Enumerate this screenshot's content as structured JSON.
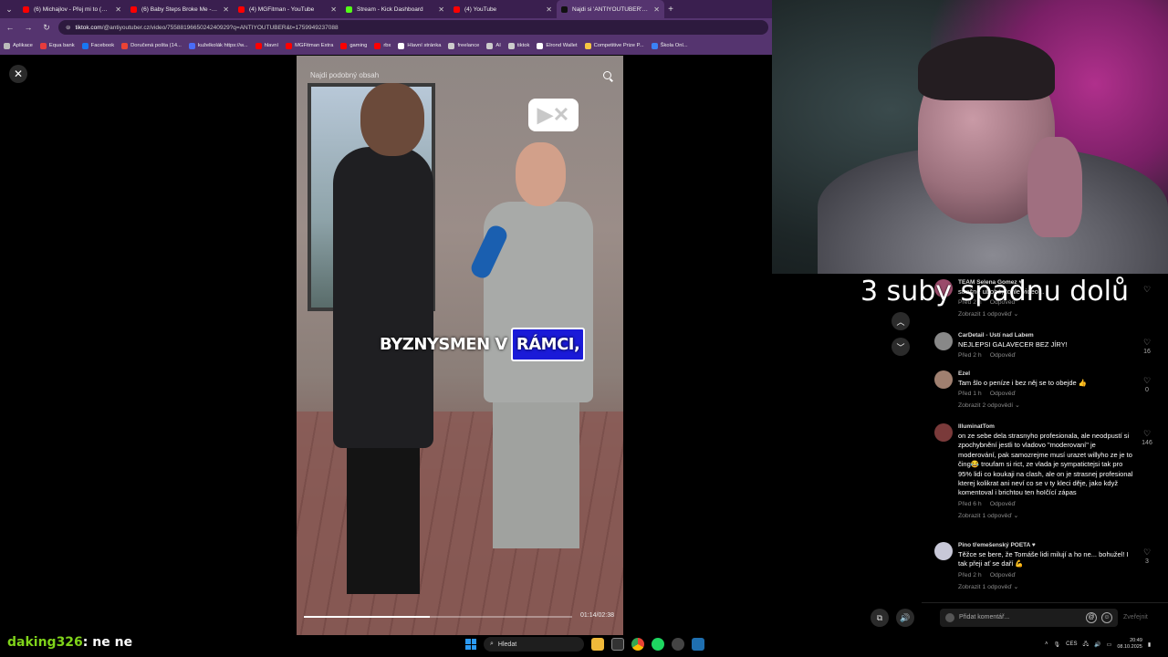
{
  "browser": {
    "tabs": [
      {
        "label": "(6) Michajlov - Přej mi to (Prod",
        "color": "#ff0000"
      },
      {
        "label": "(6) Baby Steps Broke Me - YouT",
        "color": "#ff0000"
      },
      {
        "label": "(4) MGFitman - YouTube",
        "color": "#ff0000"
      },
      {
        "label": "Stream - Kick Dashboard",
        "color": "#53fc18"
      },
      {
        "label": "(4) YouTube",
        "color": "#ff0000"
      },
      {
        "label": "Najdi si 'ANTIYOUTUBER' v ...",
        "color": "#111111",
        "active": true
      }
    ],
    "url_host": "tiktok.com",
    "url_path": "/@antiyoutuber.cz/video/7558819665024240929?q=ANTIYOUTUBER&t=1759949237088",
    "bookmarks": [
      {
        "label": "Aplikace",
        "color": "#bbbbbb"
      },
      {
        "label": "Equa bank",
        "color": "#e63c3c"
      },
      {
        "label": "Facebook",
        "color": "#1877f2"
      },
      {
        "label": "Doručená pošta (14...",
        "color": "#ea4335"
      },
      {
        "label": "kuželkolák https://w...",
        "color": "#4a6cf7"
      },
      {
        "label": "hlavní",
        "color": "#ff0000"
      },
      {
        "label": "MGFitman Extra",
        "color": "#ff0000"
      },
      {
        "label": "gaming",
        "color": "#ff0000"
      },
      {
        "label": "rbx",
        "color": "#ff0000"
      },
      {
        "label": "Hlavní stránka",
        "color": "#ffffff"
      },
      {
        "label": "freelance",
        "color": "#cccccc"
      },
      {
        "label": "AI",
        "color": "#cccccc"
      },
      {
        "label": "tiktok",
        "color": "#cccccc"
      },
      {
        "label": "Elrond Wallet",
        "color": "#ffffff"
      },
      {
        "label": "Competitive Prize P...",
        "color": "#f5c542"
      },
      {
        "label": "Škola Onl...",
        "color": "#3b82f6"
      }
    ]
  },
  "video": {
    "search_placeholder": "Najdi podobný obsah",
    "caption_plain": "BYZNYSMEN V",
    "caption_highlight": "RÁMCI,",
    "time": "01:14/02:38",
    "progress": 0.47
  },
  "overlay_text": "3 suby spadnu dolů",
  "comments": [
    {
      "author": "TEAM Selena Gomez ♥",
      "text": "strašně ubohé, tohle video...",
      "time": "Před 2 h",
      "reply": "Odpověď",
      "replies": "Zobrazit 1 odpověď",
      "likes": "",
      "avatar": "#9a4a6a"
    },
    {
      "author": "CarDetail - Ustí nad Labem",
      "text": "NEJLEPSI GALAVECER BEZ JÍRY!",
      "time": "Před 2 h",
      "reply": "Odpověď",
      "replies": "",
      "likes": "16",
      "avatar": "#888888"
    },
    {
      "author": "Ezel",
      "text": "Tam šlo o peníze i bez něj se to obejde 👍",
      "time": "Před 1 h",
      "reply": "Odpověď",
      "replies": "Zobrazit 2 odpovědí",
      "likes": "0",
      "avatar": "#a08070"
    },
    {
      "author": "IlluminatTom",
      "text": "on ze sebe dela strasnyho profesionala, ale neodpustí si zpochybnění jestli to vladovo \"moderovaní\" je moderování, pak samozrejme musí urazet willyho ze je to čing😂 troufam si rict, ze vlada je sympatictejsi tak pro 95% lidi co koukaji na clash, ale on je strasnej profesional kterej kolikrat ani neví co se v ty kleci děje, jako když komentoval i brichtou ten hoIčící zápas",
      "time": "Před 6 h",
      "reply": "Odpověď",
      "replies": "Zobrazit 1 odpověď",
      "likes": "146",
      "avatar": "#7a3a3a"
    },
    {
      "author": "Pino třemešenský POETA ♥",
      "text": "Těžce se bere, že Tomáše lidi milují a ho ne... bohužel! I tak přeji ať se daří 💪",
      "time": "Před 2 h",
      "reply": "Odpověď",
      "replies": "Zobrazit 1 odpověď",
      "likes": "3",
      "avatar": "#c8c8d8"
    }
  ],
  "comment_input": {
    "placeholder": "Přidat komentář...",
    "post_label": "Zveřejnit"
  },
  "chat": {
    "user": "daking326",
    "message": ": ne ne"
  },
  "taskbar": {
    "search_label": "Hledat",
    "language": "CES",
    "time": "20:49",
    "date": "08.10.2025"
  }
}
